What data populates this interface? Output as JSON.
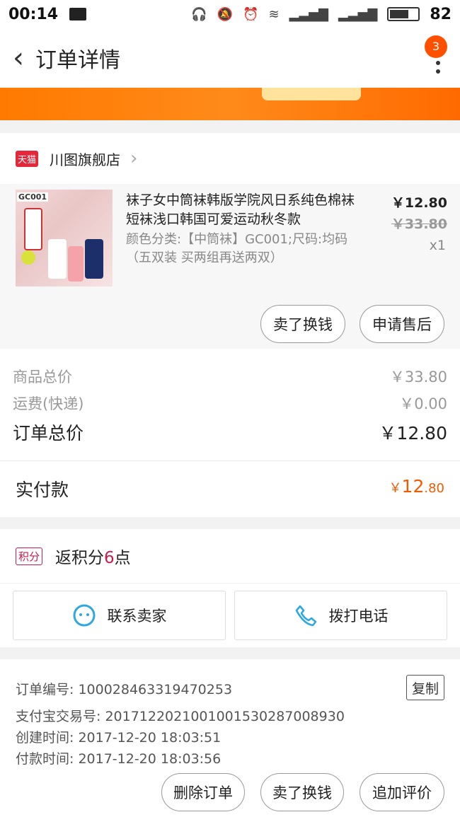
{
  "status_bar": {
    "time": "00:14",
    "battery": "82"
  },
  "header": {
    "title": "订单详情",
    "badge": "3"
  },
  "shop": {
    "tag": "天猫",
    "name": "川图旗舰店"
  },
  "item": {
    "thumb_tag": "GC001",
    "title": "袜子女中筒袜韩版学院风日系纯色棉袜短袜浅口韩国可爱运动秋冬款",
    "sku": "颜色分类:【中筒袜】GC001;尺码:均码（五双装 买两组再送两双）",
    "price": "￥12.80",
    "original_price": "￥33.80",
    "qty": "x1",
    "actions": [
      "卖了换钱",
      "申请售后"
    ]
  },
  "summary": {
    "goods_label": "商品总价",
    "goods_value": "￥33.80",
    "shipping_label": "运费(快递)",
    "shipping_value": "￥0.00",
    "total_label": "订单总价",
    "total_value": "￥12.80",
    "paid_label": "实付款",
    "paid_currency": "￥",
    "paid_int": "12",
    "paid_dec": ".80"
  },
  "points": {
    "tag": "积分",
    "text_before": "返积分",
    "num": "6",
    "text_after": "点"
  },
  "contact": {
    "seller": "联系卖家",
    "phone": "拨打电话"
  },
  "order_info": {
    "number": "订单编号: 100028463319470253",
    "copy": "复制",
    "alipay": "支付宝交易号: 2017122021001001530287008930",
    "created": "创建时间: 2017-12-20 18:03:51",
    "paid": "付款时间: 2017-12-20 18:03:56"
  },
  "bottom_actions": [
    "删除订单",
    "卖了换钱",
    "追加评价"
  ],
  "colors": {
    "accent": "#ff5000",
    "price_orange": "#f05a00",
    "points_red": "#c81c4c",
    "tmall_red": "#e4283c"
  }
}
